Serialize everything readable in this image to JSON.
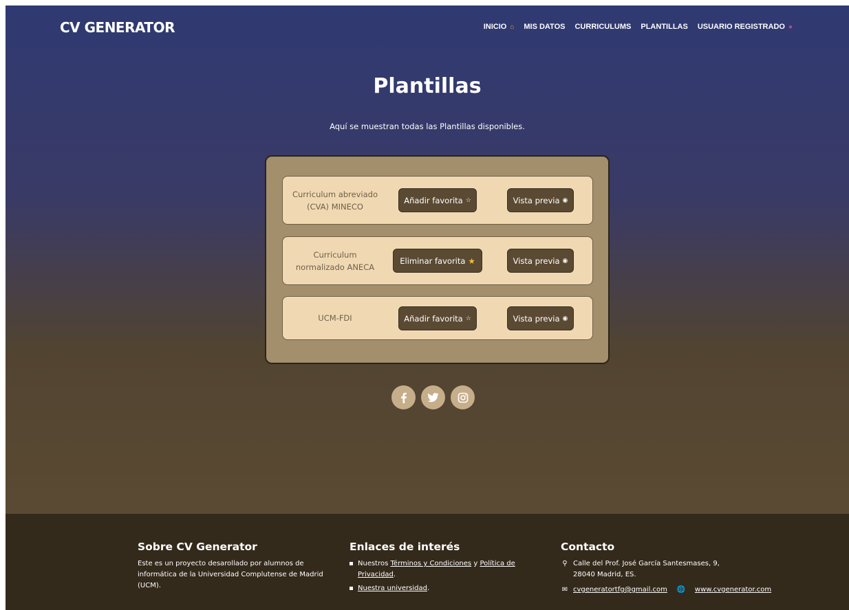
{
  "header": {
    "brand": "CV GENERATOR",
    "nav": [
      {
        "label": "INICIO",
        "icon": "house-icon"
      },
      {
        "label": "MIS DATOS"
      },
      {
        "label": "CURRICULUMS"
      },
      {
        "label": "PLANTILLAS"
      },
      {
        "label": "USUARIO REGISTRADO",
        "icon": "user-icon"
      }
    ]
  },
  "main": {
    "title": "Plantillas",
    "subtitle": "Aquí se muestran todas las Plantillas disponibles.",
    "templates": [
      {
        "name": "Curriculum abreviado (CVA) MINECO",
        "fav_label": "Añadir favorita",
        "fav_icon": "star-outline-icon",
        "preview_label": "Vista previa"
      },
      {
        "name": "Curriculum normalizado ANECA",
        "fav_label": "Eliminar favorita",
        "fav_icon": "star-filled-icon",
        "preview_label": "Vista previa"
      },
      {
        "name": "UCM-FDI",
        "fav_label": "Añadir favorita",
        "fav_icon": "star-outline-icon",
        "preview_label": "Vista previa"
      }
    ]
  },
  "socials": [
    "facebook-icon",
    "twitter-icon",
    "instagram-icon"
  ],
  "footer": {
    "about": {
      "title": "Sobre CV Generator",
      "text": "Este es un proyecto desarollado por alumnos de informática de la Universidad Complutense de Madrid (UCM)."
    },
    "links": {
      "title": "Enlaces de interés",
      "item1_prefix": "Nuestros",
      "item1_link1": "Términos y Condiciones",
      "item1_mid": "y",
      "item1_link2": "Política de Privacidad",
      "item1_suffix": ".",
      "item2_link": "Nuestra universidad",
      "item2_suffix": "."
    },
    "contact": {
      "title": "Contacto",
      "address": "Calle del Prof. José García Santesmases, 9, 28040 Madrid, ES.",
      "email": "cvgeneratortfg@gmail.com",
      "website": "www.cvgenerator.com"
    }
  },
  "colors": {
    "hero_top": "#2f3a72",
    "hero_bottom": "#5b4a33",
    "panel": "#a38f6c",
    "card": "#f0d9b2",
    "button": "#5b4a33",
    "footer": "#342a1c",
    "social": "#c6ae8a"
  }
}
